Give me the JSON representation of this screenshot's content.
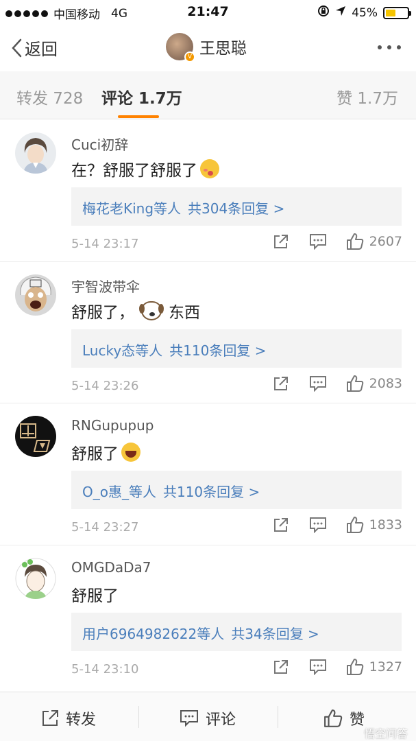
{
  "status_bar": {
    "carrier": "中国移动",
    "network": "4G",
    "time": "21:47",
    "battery": "45%",
    "battery_level": 0.45
  },
  "nav": {
    "back_label": "返回",
    "title": "王思聪"
  },
  "tabs": {
    "repost": "转发 728",
    "comments": "评论 1.7万",
    "likes": "赞 1.7万",
    "active": "comments",
    "accent_color": "#ff8200"
  },
  "comments": [
    {
      "username": "Cuci初辞",
      "text": "在？舒服了舒服了",
      "emoji": "blush-face",
      "reply_users": "梅花老King等人",
      "reply_count": "共304条回复 >",
      "time": "5-14 23:17",
      "likes": "2607"
    },
    {
      "username": "宇智波带伞",
      "text_before": "舒服了，",
      "emoji": "dog-face",
      "text_after": "东西",
      "reply_users": "Lucky态等人",
      "reply_count": "共110条回复 >",
      "time": "5-14 23:26",
      "likes": "2083"
    },
    {
      "username": "RNGupupup",
      "text": "舒服了",
      "emoji": "laughing-face",
      "reply_users": "O_o惠_等人",
      "reply_count": "共110条回复 >",
      "time": "5-14 23:27",
      "likes": "1833"
    },
    {
      "username": "OMGDaDa7",
      "text": "舒服了",
      "reply_users": "用户6964982622等人",
      "reply_count": "共34条回复 >",
      "time": "5-14 23:10",
      "likes": "1327"
    }
  ],
  "bottom_bar": {
    "repost": "转发",
    "comment": "评论",
    "like": "赞"
  },
  "watermark": "悟空问答",
  "colors": {
    "link": "#4a7ebb",
    "verify_badge": "#f39800"
  }
}
